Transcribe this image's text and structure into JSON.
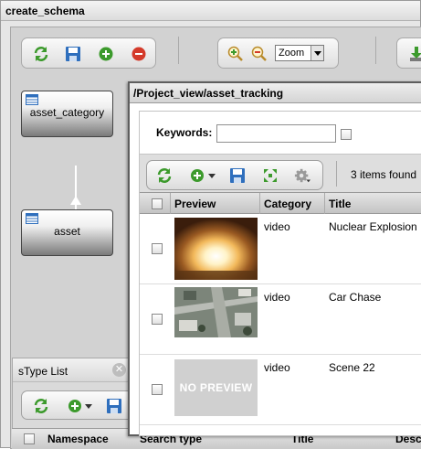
{
  "window": {
    "title": "create_schema"
  },
  "schema_toolbar": {
    "zoom_select": "Zoom",
    "icons": [
      "refresh-icon",
      "save-icon",
      "add-icon",
      "remove-icon",
      "zoom-in-icon",
      "zoom-out-icon",
      "download-icon"
    ]
  },
  "schema": {
    "nodes": [
      {
        "label": "asset_category"
      },
      {
        "label": "asset"
      }
    ]
  },
  "stype_list": {
    "title": "sType List",
    "columns": [
      "Namespace",
      "Search type",
      "Title",
      "Desc"
    ]
  },
  "inner": {
    "title": "/Project_view/asset_tracking",
    "keywords_label": "Keywords:",
    "keywords_value": "",
    "found_text": "3 items found",
    "columns": [
      "Preview",
      "Category",
      "Title"
    ],
    "rows": [
      {
        "preview": "explosion-image",
        "category": "video",
        "title": "Nuclear Explosion"
      },
      {
        "preview": "aerial-city-image",
        "category": "video",
        "title": "Car Chase"
      },
      {
        "preview": "no-preview",
        "preview_text": "NO PREVIEW",
        "category": "video",
        "title": "Scene 22"
      }
    ]
  },
  "colors": {
    "accent_green": "#3c9a2c",
    "save_blue": "#2f6fbd",
    "remove_red": "#d43a2a"
  }
}
